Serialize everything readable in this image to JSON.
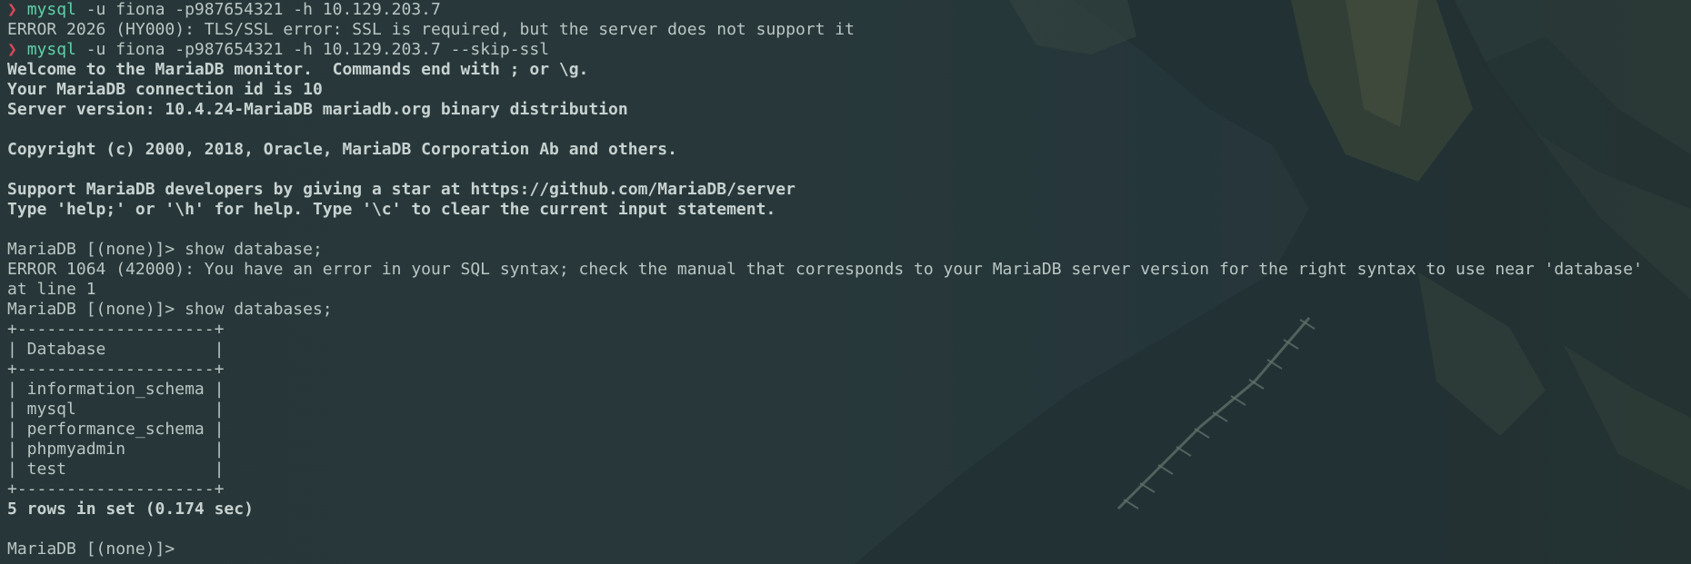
{
  "terminal": {
    "lines": [
      {
        "kind": "prompt",
        "arrow": "❯",
        "cmd": "mysql",
        "args": " -u fiona -p987654321 -h 10.129.203.7"
      },
      {
        "kind": "text",
        "text": "ERROR 2026 (HY000): TLS/SSL error: SSL is required, but the server does not support it"
      },
      {
        "kind": "prompt",
        "arrow": "❯",
        "cmd": "mysql",
        "args": " -u fiona -p987654321 -h 10.129.203.7 --skip-ssl"
      },
      {
        "kind": "bold",
        "text": "Welcome to the MariaDB monitor.  Commands end with ; or \\g."
      },
      {
        "kind": "bold",
        "text": "Your MariaDB connection id is 10"
      },
      {
        "kind": "bold",
        "text": "Server version: 10.4.24-MariaDB mariadb.org binary distribution"
      },
      {
        "kind": "blank",
        "text": ""
      },
      {
        "kind": "bold",
        "text": "Copyright (c) 2000, 2018, Oracle, MariaDB Corporation Ab and others."
      },
      {
        "kind": "blank",
        "text": ""
      },
      {
        "kind": "bold",
        "text": "Support MariaDB developers by giving a star at https://github.com/MariaDB/server"
      },
      {
        "kind": "bold",
        "text": "Type 'help;' or '\\h' for help. Type '\\c' to clear the current input statement."
      },
      {
        "kind": "blank",
        "text": ""
      },
      {
        "kind": "text",
        "text": "MariaDB [(none)]> show database;"
      },
      {
        "kind": "text",
        "text": "ERROR 1064 (42000): You have an error in your SQL syntax; check the manual that corresponds to your MariaDB server version for the right syntax to use near 'database'"
      },
      {
        "kind": "text",
        "text": "at line 1"
      },
      {
        "kind": "text",
        "text": "MariaDB [(none)]> show databases;"
      },
      {
        "kind": "text",
        "text": "+--------------------+"
      },
      {
        "kind": "text",
        "text": "| Database           |"
      },
      {
        "kind": "text",
        "text": "+--------------------+"
      },
      {
        "kind": "text",
        "text": "| information_schema |"
      },
      {
        "kind": "text",
        "text": "| mysql              |"
      },
      {
        "kind": "text",
        "text": "| performance_schema |"
      },
      {
        "kind": "text",
        "text": "| phpmyadmin         |"
      },
      {
        "kind": "text",
        "text": "| test               |"
      },
      {
        "kind": "text",
        "text": "+--------------------+"
      },
      {
        "kind": "bold",
        "text": "5 rows in set (0.174 sec)"
      },
      {
        "kind": "blank",
        "text": ""
      },
      {
        "kind": "text",
        "text": "MariaDB [(none)]> "
      }
    ]
  },
  "colors": {
    "background": "#26363a",
    "text": "#b9c6c3",
    "prompt_arrow": "#e0455a",
    "command": "#5fd1a7"
  }
}
